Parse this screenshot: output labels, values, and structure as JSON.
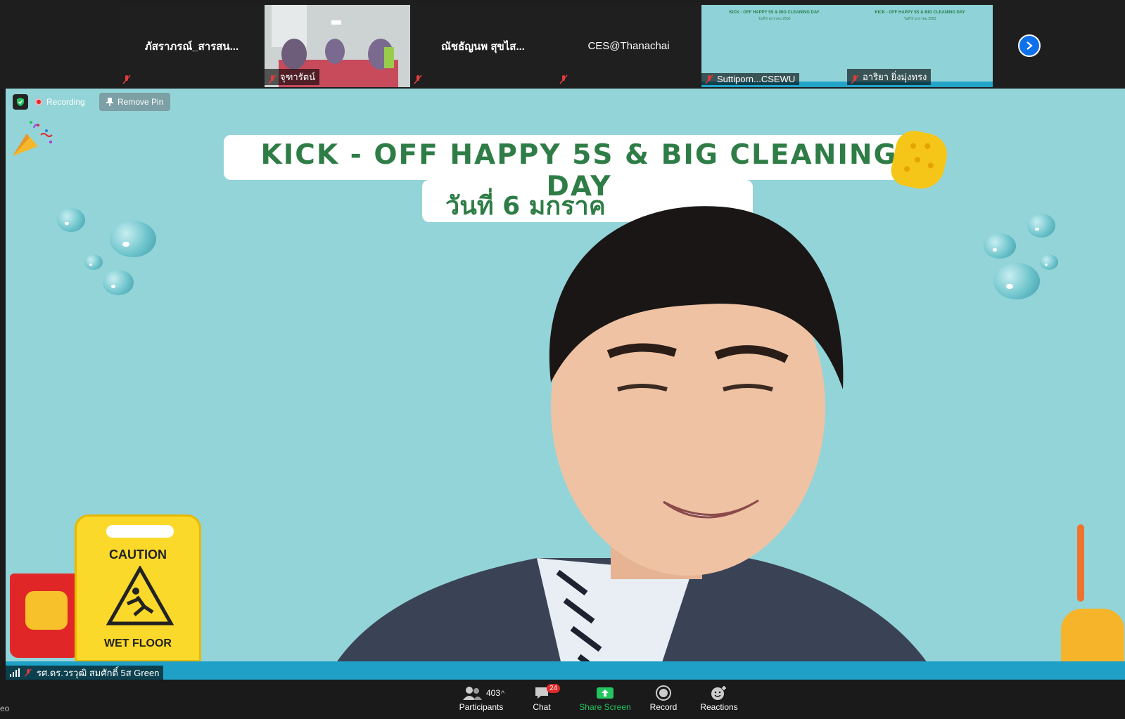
{
  "top_strip": {
    "tiles": [
      {
        "name": "ภัสราภรณ์_สารสน..."
      },
      {
        "label": "จุฑารัตน์"
      },
      {
        "name": "ณัชธัญนพ  สุขไส..."
      },
      {
        "name": "CES@Thanachai"
      },
      {
        "label": "Suttiporn...CSEWU",
        "screen_title": "KICK - OFF HAPPY 5S & BIG CLEANING DAY",
        "screen_sub": "วันที่ 6 มกราคม 2563"
      },
      {
        "label": "อาริยา ยิ่งมุ่งทรง",
        "screen_title": "KICK - OFF HAPPY 5S & BIG CLEANING DAY",
        "screen_sub": "วันที่ 6 มกราคม 2563"
      }
    ]
  },
  "stage": {
    "recording_label": "Recording",
    "remove_pin_label": "Remove Pin",
    "banner_title": "KICK - OFF HAPPY 5S & BIG CLEANING DAY",
    "banner_subtitle": "วันที่ 6 มกราค",
    "caution_text": "CAUTION",
    "wet_floor_text": "WET FLOOR",
    "speaker_name": "รศ.ดร.วรวุฒิ สมศักดิ์ 5ส Green"
  },
  "toolbar": {
    "participants_count": "403",
    "participants_label": "Participants",
    "chat_badge": "24",
    "chat_label": "Chat",
    "share_label": "Share Screen",
    "record_label": "Record",
    "reactions_label": "Reactions",
    "corner_text": "eo"
  },
  "colors": {
    "share_green": "#23c55e",
    "accent_blue": "#0e71eb",
    "stage_bg": "#93d4d9",
    "banner_text": "#2f7d46"
  }
}
